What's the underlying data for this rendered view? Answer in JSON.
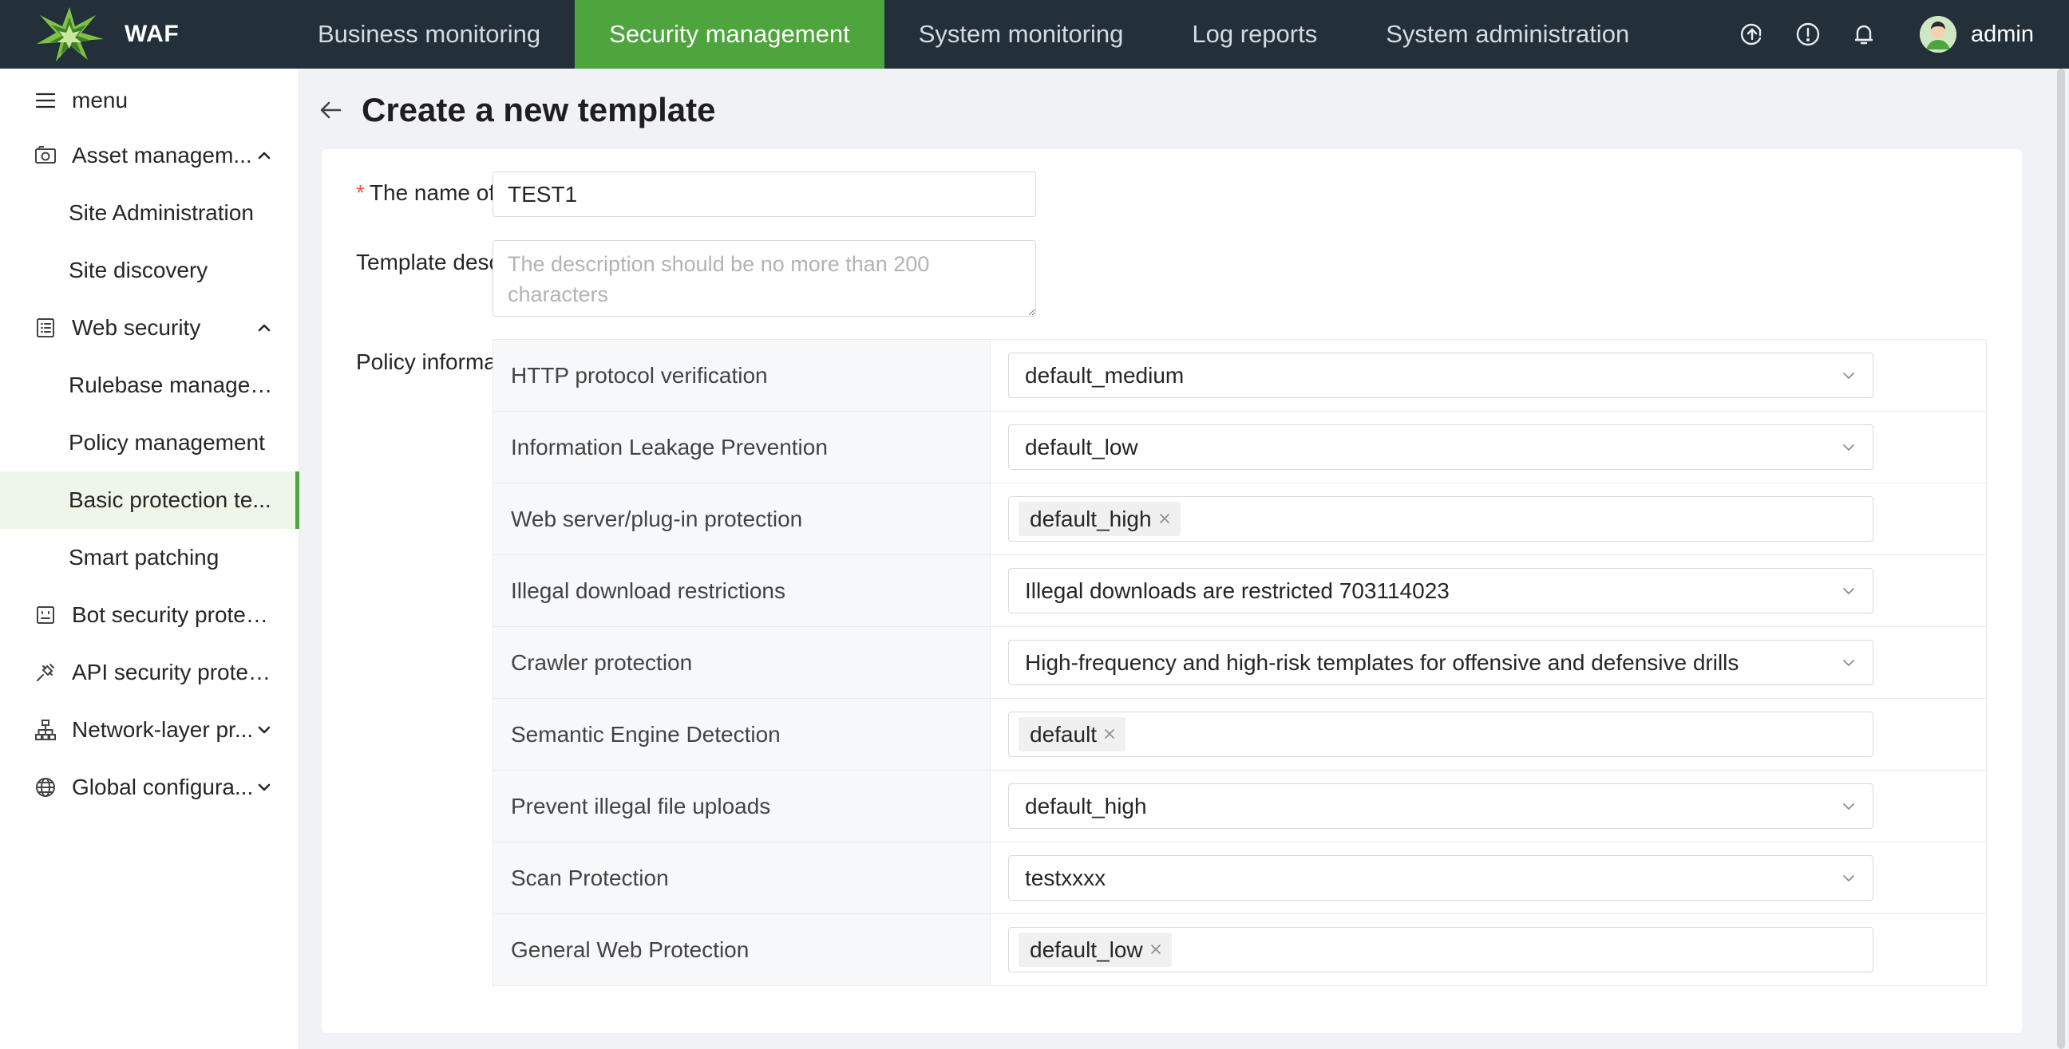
{
  "app": {
    "name": "WAF",
    "username": "admin"
  },
  "nav": {
    "items": [
      {
        "label": "Business monitoring",
        "active": false
      },
      {
        "label": "Security management",
        "active": true
      },
      {
        "label": "System monitoring",
        "active": false
      },
      {
        "label": "Log reports",
        "active": false
      },
      {
        "label": "System administration",
        "active": false
      }
    ]
  },
  "topbar_icons": [
    "upgrade-icon",
    "info-icon",
    "bell-icon"
  ],
  "sidebar": {
    "menu_label": "menu",
    "items": [
      {
        "label": "Asset managem...",
        "icon": "camera-box-icon",
        "expanded": true
      },
      {
        "label": "Site Administration",
        "sub": true
      },
      {
        "label": "Site discovery",
        "sub": true
      },
      {
        "label": "Web security",
        "icon": "list-doc-icon",
        "expanded": true
      },
      {
        "label": "Rulebase managem...",
        "sub": true
      },
      {
        "label": "Policy management",
        "sub": true
      },
      {
        "label": "Basic protection te...",
        "sub": true,
        "active": true
      },
      {
        "label": "Smart patching",
        "sub": true
      },
      {
        "label": "Bot security protect...",
        "icon": "bot-icon"
      },
      {
        "label": "API security protect...",
        "icon": "plug-icon"
      },
      {
        "label": "Network-layer pr...",
        "icon": "network-icon",
        "expanded": false
      },
      {
        "label": "Global configura...",
        "icon": "globe-icon",
        "expanded": false
      }
    ]
  },
  "page": {
    "title": "Create a new template"
  },
  "form": {
    "name_label": "The name of",
    "name_value": "TEST1",
    "desc_label": "Template desc",
    "desc_placeholder": "The description should be no more than 200 characters",
    "policy_label": "Policy informa"
  },
  "policies": [
    {
      "name": "HTTP protocol verification",
      "type": "select",
      "value": "default_medium"
    },
    {
      "name": "Information Leakage Prevention",
      "type": "select",
      "value": "default_low"
    },
    {
      "name": "Web server/plug-in protection",
      "type": "tags",
      "value": "default_high"
    },
    {
      "name": "Illegal download restrictions",
      "type": "select",
      "value": "Illegal downloads are restricted 703114023"
    },
    {
      "name": "Crawler protection",
      "type": "select",
      "value": "High-frequency and high-risk templates for offensive and defensive drills"
    },
    {
      "name": "Semantic Engine Detection",
      "type": "tags",
      "value": "default"
    },
    {
      "name": "Prevent illegal file uploads",
      "type": "select",
      "value": "default_high"
    },
    {
      "name": "Scan Protection",
      "type": "select",
      "value": "testxxxx"
    },
    {
      "name": "General Web Protection",
      "type": "tags",
      "value": "default_low"
    }
  ],
  "colors": {
    "topbar": "#243039",
    "accent": "#4ea53d",
    "active_bg": "#eef6ea",
    "required": "#ff4d4f"
  }
}
